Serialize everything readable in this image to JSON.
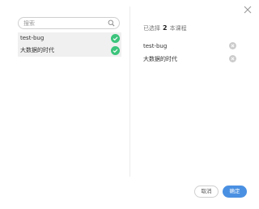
{
  "search": {
    "placeholder": "搜索"
  },
  "courses": [
    {
      "name": "test-bug",
      "checked": true,
      "icon": "check-circle-icon"
    },
    {
      "name": "大数据的时代",
      "checked": true,
      "icon": "check-circle-icon"
    }
  ],
  "summary": {
    "prefix": "已选择",
    "count": "2",
    "suffix": "本课程"
  },
  "selected": [
    {
      "name": "test-bug",
      "icon": "remove-circle-icon"
    },
    {
      "name": "大数据的时代",
      "icon": "remove-circle-icon"
    }
  ],
  "footer": {
    "cancel_label": "取消",
    "confirm_label": "确定"
  },
  "colors": {
    "accent": "#4a90e2",
    "check": "#3cc47c",
    "remove": "#cccccc"
  }
}
